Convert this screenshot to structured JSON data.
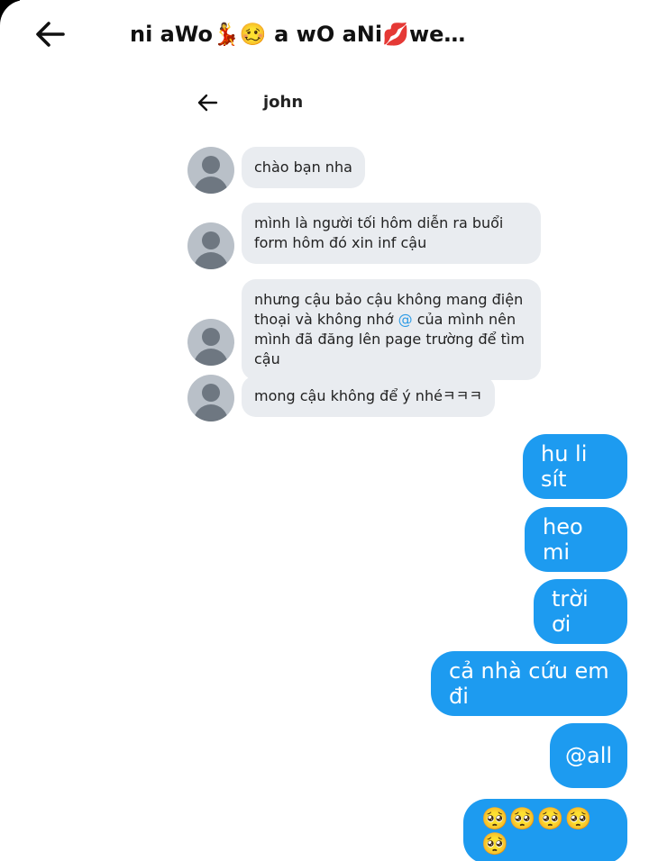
{
  "header": {
    "title": "ni aWo💃🥴 a wO aNi💋we…"
  },
  "screenshot": {
    "name": "john",
    "messages": [
      "chào bạn nha",
      "mình là người tối hôm diễn ra buổi form hôm đó xin inf cậu",
      "nhưng cậu bảo cậu không mang điện thoại và không nhớ @ của mình nên mình đã đăng lên page trường để tìm cậu",
      "mong cậu không để ý nhéㅋㅋㅋ"
    ],
    "message3_parts": [
      "nhưng cậu bảo cậu không mang điện thoại và không nhớ ",
      "@",
      " của mình nên mình đã đăng lên page trường để tìm cậu"
    ]
  },
  "outgoing": [
    "hu li sít",
    "heo mi",
    "trời ơi",
    "cả nhà cứu em đi",
    "@all",
    "🥺🥺🥺🥺🥺"
  ],
  "colors": {
    "outgoing_bubble": "#1d9bf0",
    "incoming_bubble": "#e9ecf0",
    "mention": "#2d9be6"
  }
}
